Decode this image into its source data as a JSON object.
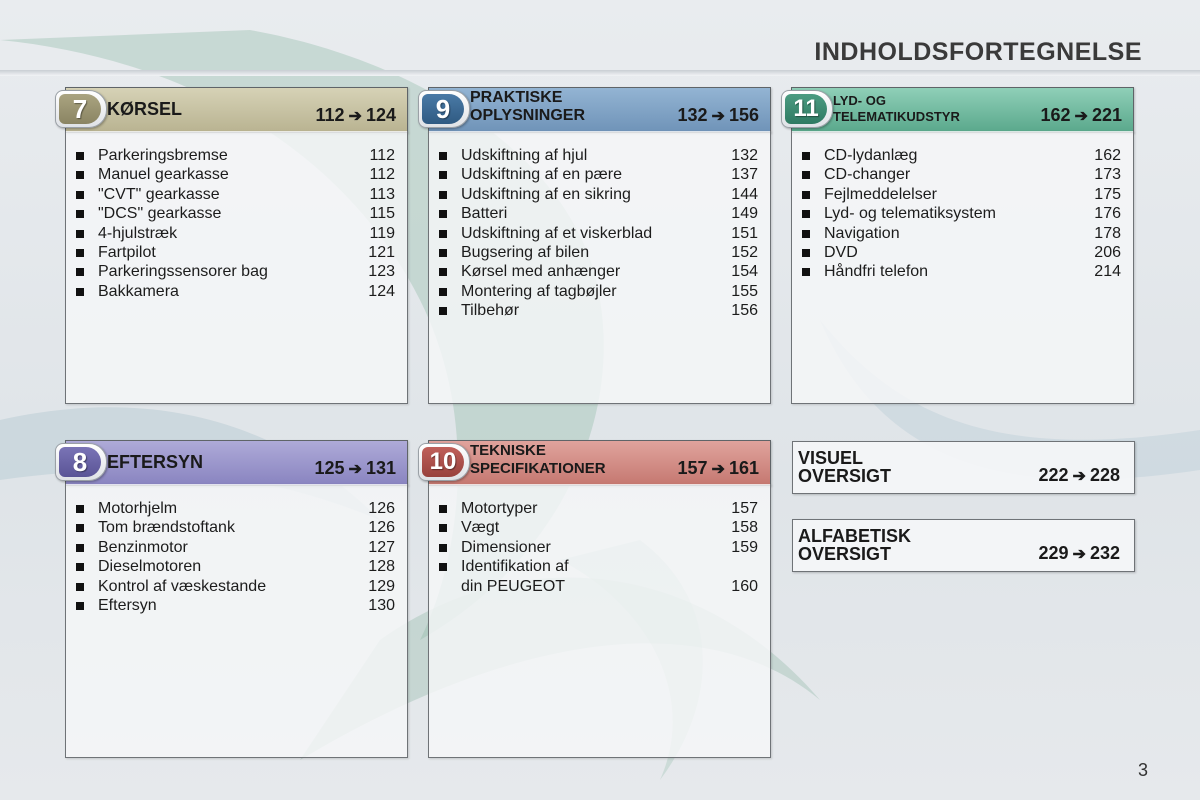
{
  "page": {
    "title": "INDHOLDSFORTEGNELSE",
    "number": "3"
  },
  "colors": {
    "section7": "#9a9472",
    "section8": "#6c66a6",
    "section9": "#3d6c96",
    "section10": "#b25650",
    "section11": "#3c8a74",
    "head7": "#c8c3a3",
    "head8": "#9f9bcc",
    "head9": "#7ea0c4",
    "head10": "#d48c86",
    "head11": "#7cc0a8"
  },
  "sections": [
    {
      "number": "7",
      "title": [
        "KØRSEL"
      ],
      "from": "112",
      "arrow": "➔",
      "to": "124",
      "items": [
        {
          "label": "Parkeringsbremse",
          "page": "112"
        },
        {
          "label": "Manuel gearkasse",
          "page": "112"
        },
        {
          "label": "\"CVT\" gearkasse",
          "page": "113"
        },
        {
          "label": "\"DCS\" gearkasse",
          "page": "115"
        },
        {
          "label": "4-hjulstræk",
          "page": "119"
        },
        {
          "label": "Fartpilot",
          "page": "121"
        },
        {
          "label": "Parkeringssensorer bag",
          "page": "123"
        },
        {
          "label": "Bakkamera",
          "page": "124"
        }
      ]
    },
    {
      "number": "9",
      "title": [
        "PRAKTISKE",
        "OPLYSNINGER"
      ],
      "from": "132",
      "arrow": "➔",
      "to": "156",
      "items": [
        {
          "label": "Udskiftning af hjul",
          "page": "132"
        },
        {
          "label": "Udskiftning af en pære",
          "page": "137"
        },
        {
          "label": "Udskiftning af en sikring",
          "page": "144"
        },
        {
          "label": "Batteri",
          "page": "149"
        },
        {
          "label": "Udskiftning af et viskerblad",
          "page": "151"
        },
        {
          "label": "Bugsering af bilen",
          "page": "152"
        },
        {
          "label": "Kørsel med anhænger",
          "page": "154"
        },
        {
          "label": "Montering af tagbøjler",
          "page": "155"
        },
        {
          "label": "Tilbehør",
          "page": "156"
        }
      ]
    },
    {
      "number": "11",
      "title": [
        "LYD- OG",
        "TELEMATIKUDSTYR"
      ],
      "from": "162",
      "arrow": "➔",
      "to": "221",
      "items": [
        {
          "label": "CD-lydanlæg",
          "page": "162"
        },
        {
          "label": "CD-changer",
          "page": "173"
        },
        {
          "label": "Fejlmeddelelser",
          "page": "175"
        },
        {
          "label": "Lyd- og telematiksystem",
          "page": "176"
        },
        {
          "label": "Navigation",
          "page": "178"
        },
        {
          "label": "DVD",
          "page": "206"
        },
        {
          "label": "Håndfri telefon",
          "page": "214"
        }
      ]
    },
    {
      "number": "8",
      "title": [
        "EFTERSYN"
      ],
      "from": "125",
      "arrow": "➔",
      "to": "131",
      "items": [
        {
          "label": "Motorhjelm",
          "page": "126"
        },
        {
          "label": "Tom brændstoftank",
          "page": "126"
        },
        {
          "label": "Benzinmotor",
          "page": "127"
        },
        {
          "label": "Dieselmotoren",
          "page": "128"
        },
        {
          "label": "Kontrol af væskestande",
          "page": "129"
        },
        {
          "label": "Eftersyn",
          "page": "130"
        }
      ]
    },
    {
      "number": "10",
      "title": [
        "TEKNISKE",
        "SPECIFIKATIONER"
      ],
      "from": "157",
      "arrow": "➔",
      "to": "161",
      "items": [
        {
          "label": "Motortyper",
          "page": "157"
        },
        {
          "label": "Vægt",
          "page": "158"
        },
        {
          "label": "Dimensioner",
          "page": "159"
        },
        {
          "label": "Identifikation af",
          "page": ""
        },
        {
          "label": "din PEUGEOT",
          "page": "160",
          "continuation": true
        }
      ]
    }
  ],
  "overviews": [
    {
      "title": [
        "VISUEL",
        "OVERSIGT"
      ],
      "from": "222",
      "arrow": "➔",
      "to": "228"
    },
    {
      "title": [
        "ALFABETISK",
        "OVERSIGT"
      ],
      "from": "229",
      "arrow": "➔",
      "to": "232"
    }
  ]
}
